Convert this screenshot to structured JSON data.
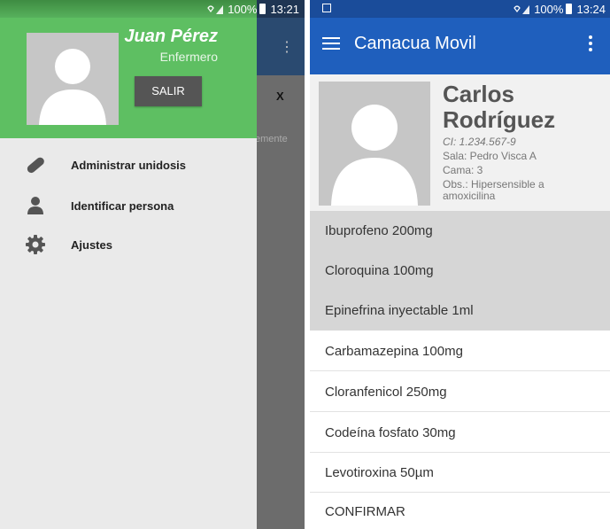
{
  "left_screen": {
    "status": {
      "battery": "100%",
      "time": "13:21"
    },
    "underlying": {
      "close_label": "X",
      "partial_text": "emente"
    },
    "drawer": {
      "user_name": "Juan Pérez",
      "user_role": "Enfermero",
      "logout_label": "SALIR",
      "items": [
        {
          "label": "Administrar unidosis",
          "icon": "pill-icon"
        },
        {
          "label": "Identificar persona",
          "icon": "person-icon"
        },
        {
          "label": "Ajustes",
          "icon": "gear-icon"
        }
      ]
    }
  },
  "right_screen": {
    "status": {
      "battery": "100%",
      "time": "13:24"
    },
    "app_title": "Camacua Movil",
    "patient": {
      "name_first": "Carlos",
      "name_last": "Rodríguez",
      "ci": "CI: 1.234.567-9",
      "sala": "Sala: Pedro Visca A",
      "cama": "Cama: 3",
      "obs_1": "Obs.: Hipersensible a",
      "obs_2": "amoxicilina"
    },
    "medications": [
      {
        "label": "Ibuprofeno 200mg",
        "selected": true
      },
      {
        "label": "Cloroquina 100mg",
        "selected": true
      },
      {
        "label": "Epinefrina inyectable 1ml",
        "selected": true
      },
      {
        "label": "Carbamazepina 100mg",
        "selected": false
      },
      {
        "label": "Cloranfenicol 250mg",
        "selected": false
      },
      {
        "label": "Codeína fosfato 30mg",
        "selected": false
      },
      {
        "label": "Levotiroxina 50µm",
        "selected": false
      }
    ],
    "confirm_label": "CONFIRMAR"
  },
  "colors": {
    "drawer_header": "#5ebf62",
    "appbar": "#1f5fbd",
    "status_bar_right": "#1a4c9a",
    "selected_row": "#d6d6d6"
  }
}
